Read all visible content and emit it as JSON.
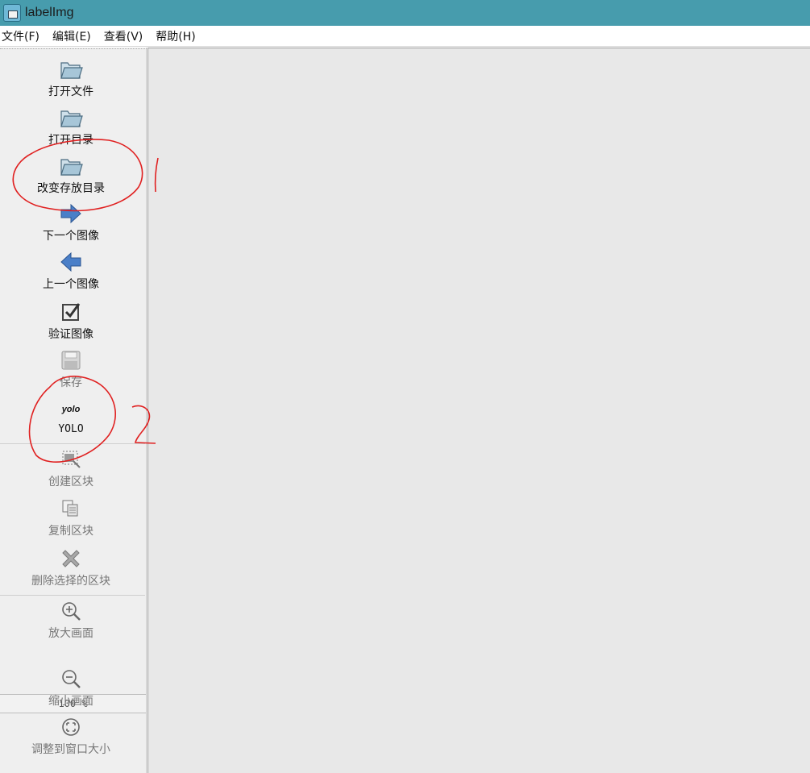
{
  "window": {
    "title": "labelImg"
  },
  "menu": [
    {
      "label": "文件(F)"
    },
    {
      "label": "编辑(E)"
    },
    {
      "label": "查看(V)"
    },
    {
      "label": "帮助(H)"
    }
  ],
  "toolbar": {
    "open_file": "打开文件",
    "open_dir": "打开目录",
    "change_save_dir": "改变存放目录",
    "next_image": "下一个图像",
    "prev_image": "上一个图像",
    "verify_image": "验证图像",
    "save": "保存",
    "yolo_icon_text": "yolo",
    "format": "YOLO",
    "create_box": "创建区块",
    "copy_box": "复制区块",
    "delete_box": "删除选择的区块",
    "zoom_in": "放大画面",
    "zoom_value": "100 %",
    "zoom_out": "缩小画面",
    "fit_window": "调整到窗口大小"
  },
  "annotations": [
    {
      "mark": "1",
      "color": "#e02020"
    },
    {
      "mark": "2",
      "color": "#e02020"
    }
  ],
  "icons": [
    "folder-icon",
    "arrow-right-icon",
    "arrow-left-icon",
    "checkbox-icon",
    "floppy-icon",
    "yolo-icon",
    "create-box-icon",
    "copy-icon",
    "delete-x-icon",
    "zoom-in-icon",
    "zoom-out-icon",
    "fit-window-icon"
  ]
}
